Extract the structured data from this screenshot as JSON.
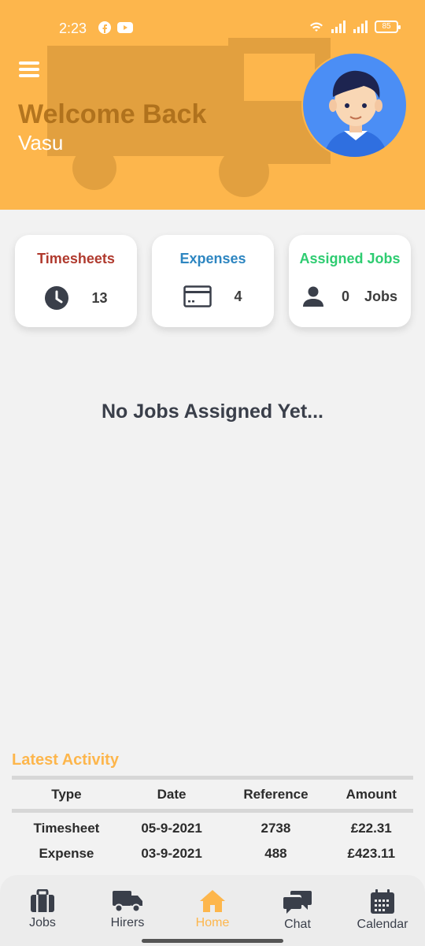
{
  "status_bar": {
    "time": "2:23",
    "battery": "85"
  },
  "header": {
    "welcome": "Welcome Back",
    "username": "Vasu"
  },
  "cards": {
    "timesheets": {
      "title": "Timesheets",
      "value": "13",
      "color": "#b03a2e"
    },
    "expenses": {
      "title": "Expenses",
      "value": "4",
      "color": "#2e86c1"
    },
    "assigned": {
      "title": "Assigned Jobs",
      "value": "0",
      "suffix": "Jobs",
      "color": "#2ecc71"
    }
  },
  "empty_message": "No Jobs Assigned Yet...",
  "activity": {
    "title": "Latest Activity",
    "columns": [
      "Type",
      "Date",
      "Reference",
      "Amount"
    ],
    "rows": [
      [
        "Timesheet",
        "05-9-2021",
        "2738",
        "£22.31"
      ],
      [
        "Expense",
        "03-9-2021",
        "488",
        "£423.11"
      ]
    ]
  },
  "nav": {
    "items": [
      {
        "label": "Jobs",
        "icon": "briefcase-icon"
      },
      {
        "label": "Hirers",
        "icon": "truck-icon"
      },
      {
        "label": "Home",
        "icon": "home-icon",
        "active": true
      },
      {
        "label": "Chat",
        "icon": "chat-icon"
      },
      {
        "label": "Calendar",
        "icon": "calendar-icon"
      }
    ]
  },
  "colors": {
    "accent": "#fdb64c",
    "text_dark": "#3a3f4a"
  }
}
